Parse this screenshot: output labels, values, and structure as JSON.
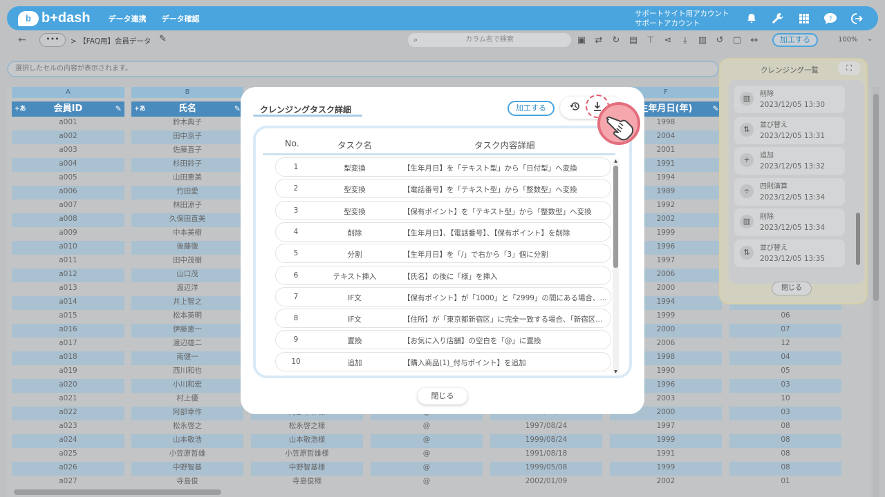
{
  "header": {
    "logo": "b+dash",
    "nav": [
      "データ連携",
      "データ確認"
    ],
    "account": [
      "サポートサイト用アカウント",
      "サポートアカウント"
    ]
  },
  "toolbar": {
    "breadcrumb": "> 【FAQ用】会員データ",
    "search_placeholder": "カラム名で検索",
    "process_label": "加工する",
    "zoom": "100%"
  },
  "cell_info": "選択したセルの内容が表示されます。",
  "grid": {
    "columns": [
      {
        "letter": "A",
        "header": "会員ID",
        "values": [
          "a001",
          "a002",
          "a003",
          "a004",
          "a005",
          "a006",
          "a007",
          "a008",
          "a009",
          "a010",
          "a011",
          "a012",
          "a013",
          "a014",
          "a015",
          "a016",
          "a017",
          "a018",
          "a019",
          "a020",
          "a021",
          "a022",
          "a023",
          "a024",
          "a025",
          "a026",
          "a027"
        ]
      },
      {
        "letter": "B",
        "header": "氏名",
        "values": [
          "鈴木典子",
          "田中京子",
          "佐藤直子",
          "杉田鈴子",
          "山田恵美",
          "竹田愛",
          "林田涼子",
          "久保田直美",
          "中本美樹",
          "後藤徹",
          "田中茂樹",
          "山口茂",
          "渡辺洋",
          "井上智之",
          "松本英明",
          "伊藤恵一",
          "渡辺雄二",
          "南健一",
          "西川和也",
          "小川和宏",
          "村上優",
          "阿部幸作",
          "松永啓之",
          "山本敬浩",
          "小笠原哲雄",
          "中野智基",
          "寺島俊"
        ]
      },
      {
        "letter": "",
        "header": "",
        "values": [
          "",
          "",
          "",
          "",
          "",
          "",
          "",
          "",
          "",
          "",
          "",
          "",
          "",
          "",
          "",
          "",
          "",
          "",
          "",
          "",
          "",
          "阿部幸作様",
          "松永啓之様",
          "山本敬浩様",
          "小笠原哲雄様",
          "中野智基様",
          "寺島俊様"
        ]
      },
      {
        "letter": "",
        "header": "",
        "values": [
          "",
          "",
          "",
          "",
          "",
          "",
          "",
          "",
          "",
          "",
          "",
          "",
          "",
          "",
          "",
          "",
          "",
          "",
          "",
          "",
          "",
          "@",
          "@",
          "@",
          "@",
          "@",
          "@"
        ]
      },
      {
        "letter": "",
        "header": "",
        "values": [
          "",
          "",
          "",
          "",
          "",
          "",
          "",
          "",
          "",
          "",
          "",
          "",
          "",
          "",
          "",
          "",
          "",
          "",
          "",
          "",
          "",
          "2000/03/12",
          "1997/08/24",
          "1999/08/24",
          "1991/08/18",
          "1999/05/08",
          "2002/01/09"
        ]
      },
      {
        "letter": "F",
        "header": "生年月日(年)",
        "values": [
          "1998",
          "2004",
          "2001",
          "1991",
          "1994",
          "1989",
          "1992",
          "2002",
          "1999",
          "1996",
          "1997",
          "2006",
          "2000",
          "1994",
          "1999",
          "2000",
          "2006",
          "1998",
          "1990",
          "1996",
          "2003",
          "2000",
          "1997",
          "1999",
          "1991",
          "1999",
          "2002"
        ]
      },
      {
        "letter": "",
        "header": "",
        "values": [
          "",
          "",
          "",
          "",
          "",
          "",
          "",
          "",
          "",
          "",
          "",
          "",
          "",
          "09",
          "06",
          "07",
          "12",
          "04",
          "05",
          "03",
          "10",
          "03",
          "08",
          "08",
          "08",
          "08",
          "01"
        ]
      }
    ]
  },
  "cleansing_panel": {
    "title": "クレンジング一覧",
    "items": [
      {
        "icon": "trash-icon",
        "name": "削除",
        "date": "2023/12/05 13:30"
      },
      {
        "icon": "sort-icon",
        "name": "並び替え",
        "date": "2023/12/05 13:31"
      },
      {
        "icon": "plus-icon",
        "name": "追加",
        "date": "2023/12/05 13:32"
      },
      {
        "icon": "calc-icon",
        "name": "四則演算",
        "date": "2023/12/05 13:34"
      },
      {
        "icon": "trash-icon",
        "name": "削除",
        "date": "2023/12/05 13:34"
      },
      {
        "icon": "sort-icon",
        "name": "並び替え",
        "date": "2023/12/05 13:35"
      }
    ],
    "close": "閉じる"
  },
  "modal": {
    "title": "クレンジングタスク詳細",
    "process_label": "加工する",
    "columns": {
      "no": "No.",
      "name": "タスク名",
      "detail": "タスク内容詳細"
    },
    "rows": [
      {
        "no": "1",
        "name": "型変換",
        "detail": "【生年月日】を「テキスト型」から「日付型」へ変換"
      },
      {
        "no": "2",
        "name": "型変換",
        "detail": "【電話番号】を「テキスト型」から「整数型」へ変換"
      },
      {
        "no": "3",
        "name": "型変換",
        "detail": "【保有ポイント】を「テキスト型」から「整数型」へ変換"
      },
      {
        "no": "4",
        "name": "削除",
        "detail": "【生年月日】、【電話番号】、【保有ポイント】を削除"
      },
      {
        "no": "5",
        "name": "分割",
        "detail": "【生年月日】を「/」で右から「3」個に分割"
      },
      {
        "no": "6",
        "name": "テキスト挿入",
        "detail": "【氏名】の後に「様」を挿入"
      },
      {
        "no": "7",
        "name": "IF文",
        "detail": "【保有ポイント】が「1000」と「2999」の間にある場合、..."
      },
      {
        "no": "8",
        "name": "IF文",
        "detail": "【住所】が「東京都新宿区」に完全一致する場合、「新宿区..."
      },
      {
        "no": "9",
        "name": "置換",
        "detail": "【お気に入り店舗】の空白を「@」に置換"
      },
      {
        "no": "10",
        "name": "追加",
        "detail": "【購入商品(1)_付与ポイント】を追加"
      }
    ],
    "close": "閉じる"
  }
}
